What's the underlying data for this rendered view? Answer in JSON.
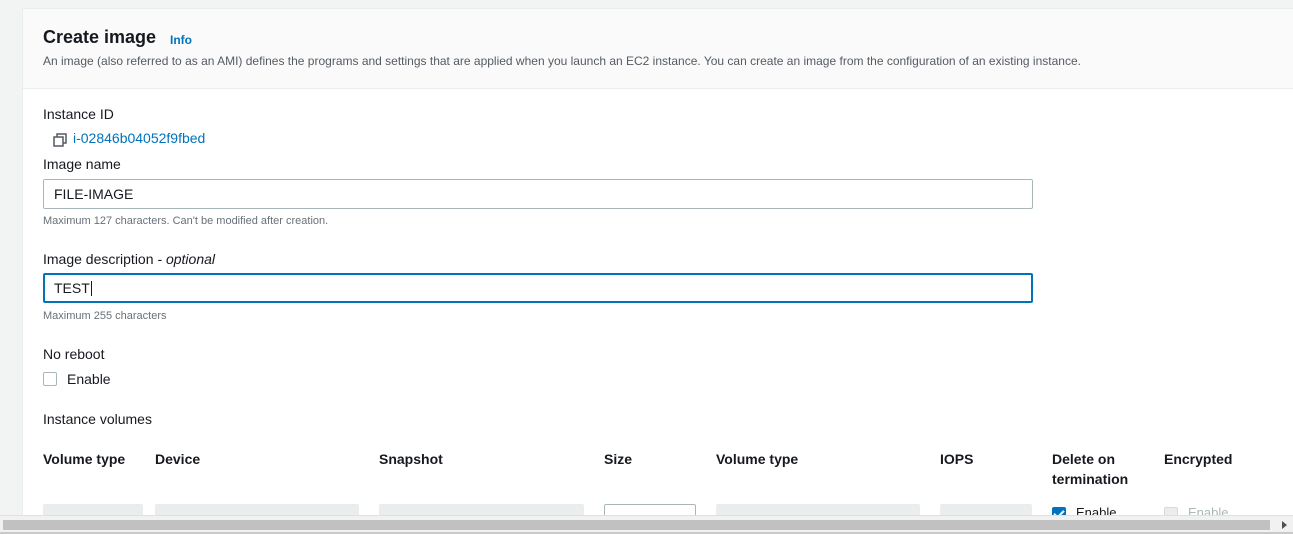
{
  "header": {
    "title": "Create image",
    "info_label": "Info",
    "description": "An image (also referred to as an AMI) defines the programs and settings that are applied when you launch an EC2 instance. You can create an image from the configuration of an existing instance."
  },
  "instance": {
    "label": "Instance ID",
    "copy_icon": "copy-icon",
    "id": "i-02846b04052f9fbed"
  },
  "image_name": {
    "label": "Image name",
    "value": "FILE-IMAGE",
    "hint": "Maximum 127 characters. Can't be modified after creation."
  },
  "image_description": {
    "label": "Image description",
    "label_optional": " - optional",
    "value": "TEST",
    "hint": "Maximum 255 characters"
  },
  "no_reboot": {
    "label": "No reboot",
    "option_label": "Enable",
    "checked": false
  },
  "volumes": {
    "label": "Instance volumes",
    "columns": [
      "Volume type",
      "Device",
      "Snapshot",
      "Size",
      "Volume type",
      "IOPS",
      "Delete on termination",
      "Encrypted"
    ],
    "row": {
      "delete_on_termination_label": "Enable",
      "delete_on_termination_checked": true,
      "encrypted_label": "Enable",
      "encrypted_checked": false
    }
  },
  "colors": {
    "link": "#0073bb",
    "focus": "#0073bb",
    "header_bg": "#fafafa",
    "text": "#16191f",
    "muted": "#687078"
  }
}
